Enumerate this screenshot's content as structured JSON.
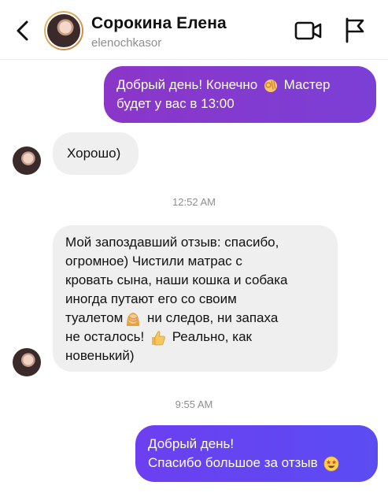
{
  "header": {
    "name": "Сорокина Елена",
    "username": "elenochkasor"
  },
  "messages": [
    {
      "lines": [
        "Добрый день! Конечно",
        "Мастер",
        "будет у вас в 13:00"
      ]
    },
    {
      "lines": [
        "Хорошо)"
      ]
    },
    {
      "time": "12:52 AM"
    },
    {
      "lines": [
        "Мой запоздавший отзыв: спасибо,",
        "огромное) Чистили матрас с",
        "кровать сына, наши кошка и собака",
        "иногда путают его со своим",
        "туалетом",
        "ни следов, ни запаха",
        "не осталось!",
        "Реально, как",
        "новенький)"
      ]
    },
    {
      "time": "9:55 AM"
    },
    {
      "lines": [
        "Добрый день!",
        "Спасибо большое за отзыв"
      ]
    }
  ],
  "icons": {
    "back": "chevron-left-icon",
    "video": "video-camera-icon",
    "flag": "flag-icon",
    "emoji_ok": "ok-hand-emoji",
    "emoji_facepalm": "woman-facepalming-emoji",
    "emoji_thumbs": "thumbs-up-emoji",
    "emoji_starstruck": "star-struck-emoji"
  },
  "colors": {
    "outgoing_1": "#8b36c8",
    "outgoing_2": "#6c3ff0",
    "incoming": "#efefef"
  }
}
